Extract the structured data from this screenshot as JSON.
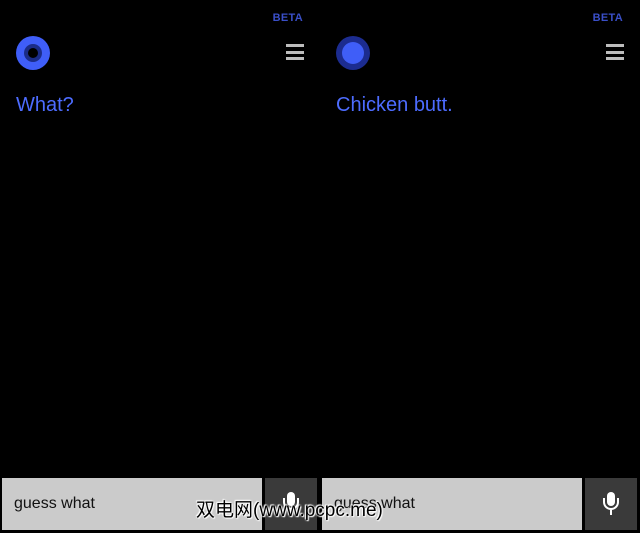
{
  "panels": [
    {
      "beta_label": "BETA",
      "orb_state": "listening",
      "orb_icon": "cortana-orb-icon",
      "menu_icon": "hamburger-menu-icon",
      "response_text": "What?",
      "input_value": "guess what",
      "mic_icon": "microphone-icon"
    },
    {
      "beta_label": "BETA",
      "orb_state": "speaking",
      "orb_icon": "cortana-orb-icon",
      "menu_icon": "hamburger-menu-icon",
      "response_text": "Chicken butt.",
      "input_value": "guess what",
      "mic_icon": "microphone-icon"
    }
  ],
  "watermark": "双电网(www.pcpc.me)",
  "colors": {
    "accent": "#4d6cff",
    "orb_ring": "#3f5ef8",
    "beta": "#3a4fc8",
    "input_bg": "#cbcbcb",
    "mic_bg": "#3a3a3a",
    "background": "#000000"
  }
}
